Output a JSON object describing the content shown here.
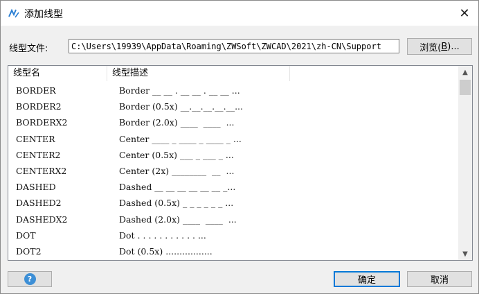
{
  "window": {
    "title": "添加线型",
    "app_icon": "linetype-icon",
    "close_glyph": "✕"
  },
  "path": {
    "label": "线型文件:",
    "value": "C:\\Users\\19939\\AppData\\Roaming\\ZWSoft\\ZWCAD\\2021\\zh-CN\\Support",
    "browse_button_label_prefix": "浏览(",
    "browse_button_accel": "B",
    "browse_button_label_suffix": ")..."
  },
  "list": {
    "columns": [
      "线型名",
      "线型描述"
    ],
    "rows": [
      {
        "name": "BORDER",
        "desc": "Border __ __ . __ __ . __ __ ..."
      },
      {
        "name": "BORDER2",
        "desc": "Border (0.5x) __.__.__.__.__..."
      },
      {
        "name": "BORDERX2",
        "desc": "Border (2.0x) ____  ____  ..."
      },
      {
        "name": "CENTER",
        "desc": "Center ____ _ ____ _ ____ _ ..."
      },
      {
        "name": "CENTER2",
        "desc": "Center (0.5x) ___ _ ___ _ ..."
      },
      {
        "name": "CENTERX2",
        "desc": "Center (2x) ________  __  ..."
      },
      {
        "name": "DASHED",
        "desc": "Dashed __ __ __ __ __ __ _..."
      },
      {
        "name": "DASHED2",
        "desc": "Dashed (0.5x) _ _ _ _ _ _ ..."
      },
      {
        "name": "DASHEDX2",
        "desc": "Dashed (2.0x) ____  ____  ..."
      },
      {
        "name": "DOT",
        "desc": "Dot . . . . . . . . . . . ..."
      },
      {
        "name": "DOT2",
        "desc": "Dot (0.5x) ................."
      }
    ]
  },
  "buttons": {
    "help": "?",
    "ok": "确定",
    "cancel": "取消"
  },
  "colors": {
    "accent": "#0078d7",
    "help_icon": "#3d8fd6"
  }
}
